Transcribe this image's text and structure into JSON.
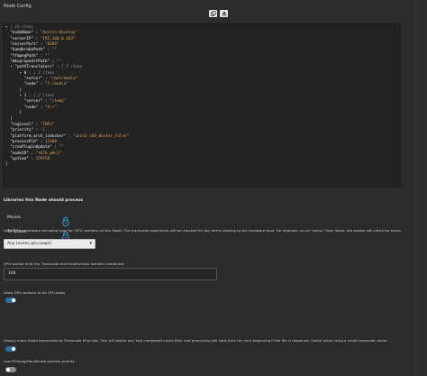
{
  "header": {
    "title": "Node Config"
  },
  "toolbar": {
    "copy_icon": "copy-icon",
    "upload_icon": "upload-icon"
  },
  "json_view": {
    "root_count": "{ 18 items",
    "lines": [
      {
        "type": "kv",
        "key": "\"nodeName\"",
        "val": "\"Austin-Desktop\""
      },
      {
        "type": "kv",
        "key": "\"serverIP\"",
        "val": "\"192.168.0.163\""
      },
      {
        "type": "kv",
        "key": "\"serverPort\"",
        "val": "\"8266\""
      },
      {
        "type": "kv",
        "key": "\"handbrakePath\"",
        "val": "\"\""
      },
      {
        "type": "kv",
        "key": "\"ffmpegPath\"",
        "val": "\"\""
      },
      {
        "type": "kv",
        "key": "\"mkvpropeditPath\"",
        "val": "\"\""
      },
      {
        "type": "arr_open",
        "key": "\"pathTranslators\"",
        "count": "[ 2 items"
      },
      {
        "type": "obj_open",
        "key": "0",
        "count": "{ 2 items"
      },
      {
        "type": "kv2",
        "key": "\"server\"",
        "val": "\"/mnt/media\""
      },
      {
        "type": "kv2",
        "key": "\"node\"",
        "val": "\"F:/media\""
      },
      {
        "type": "close",
        "text": "}"
      },
      {
        "type": "obj_open",
        "key": "1",
        "count": "{ 2 items"
      },
      {
        "type": "kv2",
        "key": "\"server\"",
        "val": "\"/temp\""
      },
      {
        "type": "kv2",
        "key": "\"node\"",
        "val": "\"X:/\""
      },
      {
        "type": "close",
        "text": "}"
      },
      {
        "type": "close_arr",
        "text": "]"
      },
      {
        "type": "kv",
        "key": "\"logLevel\"",
        "val": "\"INFO\""
      },
      {
        "type": "kv",
        "key": "\"priority\"",
        "val": "-1"
      },
      {
        "type": "kv",
        "key": "\"platform_arch_isdocker\"",
        "val": "\"win32_x64_docker_false\""
      },
      {
        "type": "kv",
        "key": "\"processPid\"",
        "val": "15400"
      },
      {
        "type": "kv",
        "key": "\"cronPluginUpdate\"",
        "val": "\"\""
      },
      {
        "type": "kv",
        "key": "\"nodeID\"",
        "val": "\"t67b_wHc1\""
      },
      {
        "type": "kv",
        "key": "\"uptime\"",
        "val": "159750"
      }
    ],
    "root_close": "}"
  },
  "libraries": {
    "heading": "Libraries this Node should process",
    "items": [
      {
        "label": "Movies",
        "icon": "unlocked-icon"
      },
      {
        "label": "TV Shows",
        "icon": "unlocked-icon"
      }
    ]
  },
  "hw_encoding": {
    "description": "Specify the hardware encoding type for 'GPU' workers on this Node. The transcode arguments will be checked for key terms relating to the hardware type. For example, on an 'nvenc' Tdarr Node, the worker will check for terms like 'nvenc', 'cuda' and 'cuvid'.",
    "selected": "Any (nvenc,qsv,vaapi)"
  },
  "gpu_limit": {
    "label": "GPU worker limit (for Transcode and Healthcheck workers combined)",
    "value": "100"
  },
  "gpu_cpu_tasks": {
    "label": "Allow GPU workers to do CPU tasks",
    "state": "on"
  },
  "move_failed": {
    "label": "Always move failed transcodes to Transcode Error tab. This will delete any 'last completed cache files' and processing will start from the very beginning if the file is requeued. Useful when using a small transcode cache.",
    "state": "on"
  },
  "low_priority": {
    "label": "Low FFmpeg/HandBrake process priority",
    "state": "off"
  },
  "colors": {
    "accent": "#2f6f9f",
    "string": "#d6a257",
    "background": "#2b2b2b",
    "panel": "#232323"
  }
}
